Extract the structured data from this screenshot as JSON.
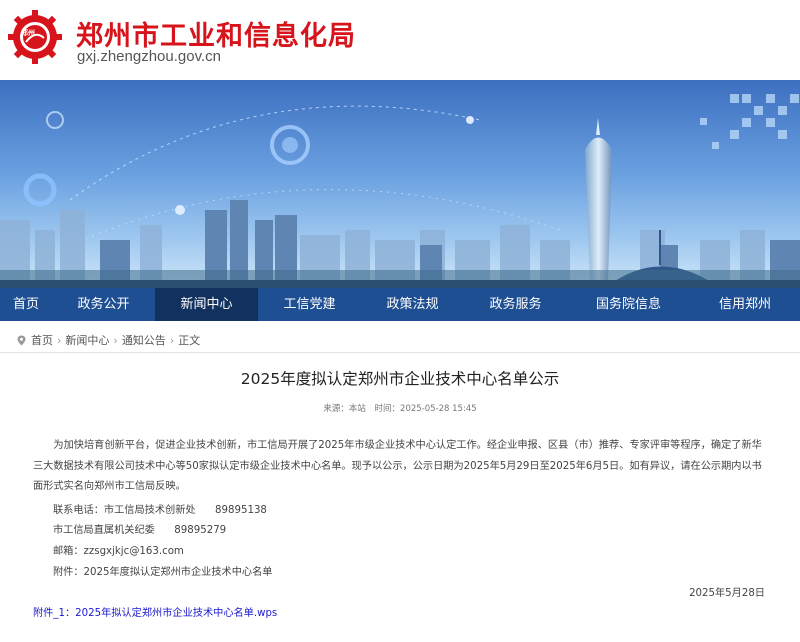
{
  "header": {
    "logo_text": "郑州",
    "title": "郑州市工业和信息化局",
    "domain": "gxj.zhengzhou.gov.cn",
    "brand_color": "#d7141b"
  },
  "nav": {
    "items": [
      {
        "label": "首页"
      },
      {
        "label": "政务公开"
      },
      {
        "label": "新闻中心"
      },
      {
        "label": "工信党建"
      },
      {
        "label": "政策法规"
      },
      {
        "label": "政务服务"
      },
      {
        "label": "国务院信息"
      },
      {
        "label": "信用郑州"
      }
    ],
    "active_index": 2,
    "bg_color": "#1f4f93",
    "active_color": "#12315e"
  },
  "breadcrumb": {
    "home": "首页",
    "news": "新闻中心",
    "notice": "通知公告",
    "current": "正文"
  },
  "article": {
    "title": "2025年度拟认定郑州市企业技术中心名单公示",
    "source_label": "来源：本站",
    "time_label": "时间：2025-05-28 15:45",
    "paragraph": "为加快培育创新平台，促进企业技术创新，市工信局开展了2025年市级企业技术中心认定工作。经企业申报、区县（市）推荐、专家评审等程序，确定了新华三大数据技术有限公司技术中心等50家拟认定市级企业技术中心名单。现予以公示，公示日期为2025年5月29日至2025年6月5日。如有异议，请在公示期内以书面形式实名向郑州市工信局反映。",
    "contact_phone_line": "联系电话：市工信局技术创新处      89895138",
    "discipline_line": "市工信局直属机关纪委      89895279",
    "email_line": "邮箱：zzsgxjkjc@163.com",
    "attachment_line": "附件：2025年度拟认定郑州市企业技术中心名单",
    "date_sign": "2025年5月28日",
    "attachment_link": "附件_1：2025年拟认定郑州市企业技术中心名单.wps"
  }
}
